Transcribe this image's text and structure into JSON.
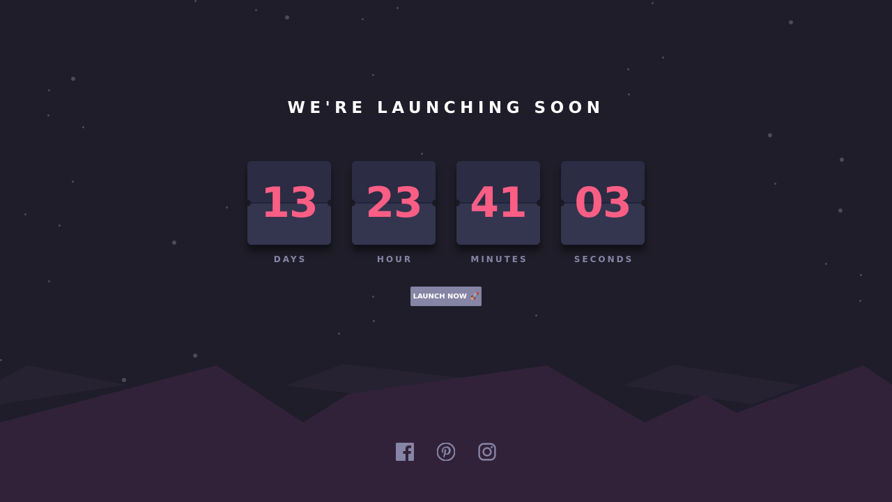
{
  "heading": "WE'RE LAUNCHING SOON",
  "counters": [
    {
      "value": "13",
      "label": "DAYS"
    },
    {
      "value": "23",
      "label": "HOUR"
    },
    {
      "value": "41",
      "label": "MINUTES"
    },
    {
      "value": "03",
      "label": "SECONDS"
    }
  ],
  "launch_button": {
    "label": "LAUNCH NOW",
    "icon": "rocket-icon"
  },
  "socials": [
    {
      "icon": "facebook-icon"
    },
    {
      "icon": "pinterest-icon"
    },
    {
      "icon": "instagram-icon"
    }
  ],
  "colors": {
    "background": "#1e1d29",
    "accent": "#fb5e84",
    "card": "#343650",
    "muted": "#8785a5",
    "hills": "#31223a"
  }
}
